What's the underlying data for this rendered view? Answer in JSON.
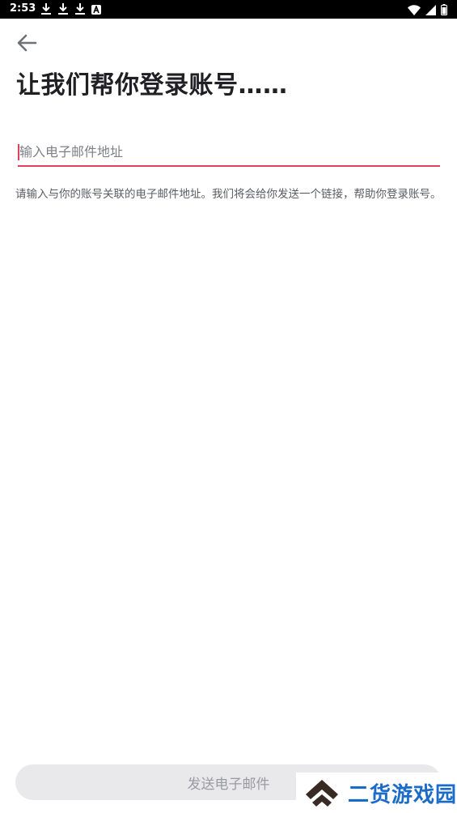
{
  "status_bar": {
    "time": "2:53"
  },
  "page": {
    "title": "让我们帮你登录账号……",
    "email_placeholder": "输入电子邮件地址",
    "email_value": "",
    "helper_text": "请输入与你的账号关联的电子邮件地址。我们将会给你发送一个链接，帮助你登录账号。",
    "send_button_label": "发送电子邮件"
  },
  "watermark": {
    "text": "二货游戏园"
  },
  "colors": {
    "accent": "#e0405a",
    "title": "#1f1f24",
    "button_bg": "#e9e9ec",
    "button_text": "#9a9ba1",
    "watermark": "#1a6cc8"
  },
  "icons": {
    "back": "arrow-left-icon",
    "status_left": [
      "download-icon",
      "download-icon",
      "download-icon",
      "app-notification-icon"
    ],
    "status_right": [
      "wifi-icon",
      "signal-icon",
      "battery-icon"
    ]
  }
}
